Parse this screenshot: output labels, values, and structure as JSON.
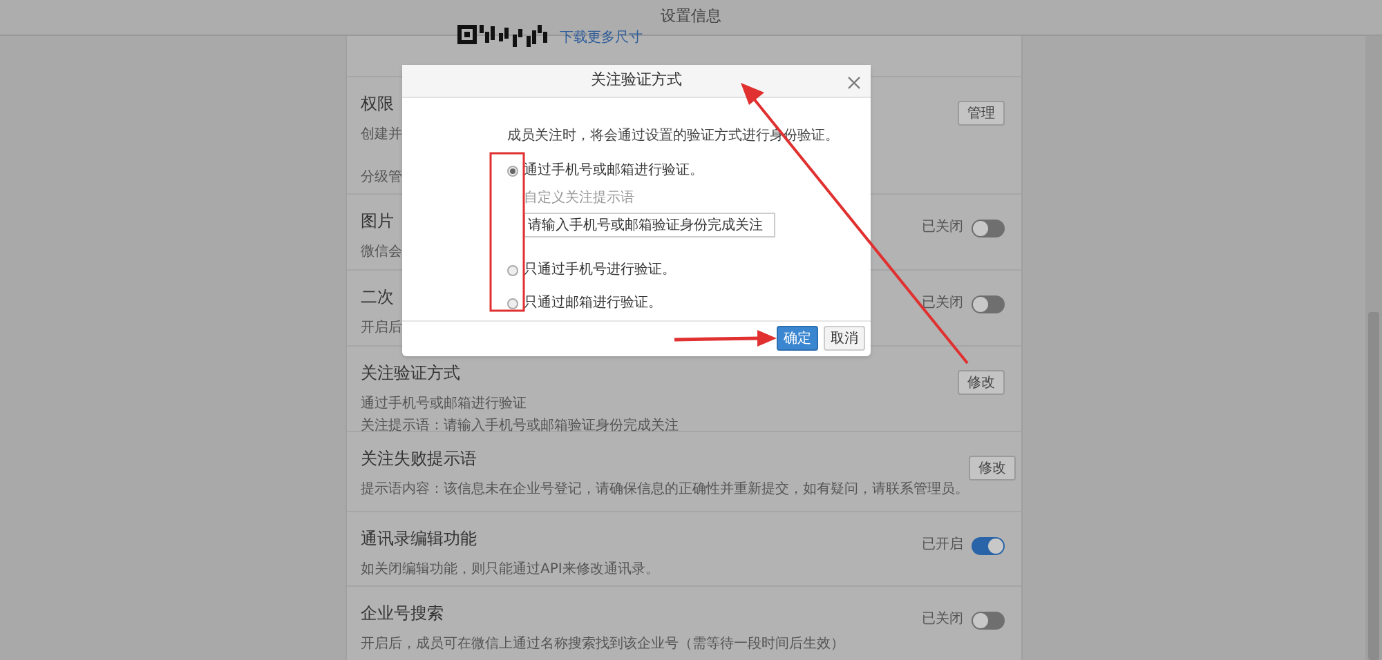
{
  "header": {
    "title": "设置信息"
  },
  "qr_row": {
    "link": "下载更多尺寸"
  },
  "settings": [
    {
      "title": "权限",
      "description": [
        "创建并",
        "分级管"
      ],
      "control": {
        "kind": "button",
        "label": "管理"
      }
    },
    {
      "title": "图片",
      "description": [
        "微信会"
      ],
      "control": {
        "kind": "toggle",
        "status": "已关闭",
        "on": false
      }
    },
    {
      "title": "二次",
      "description": [
        "开启后"
      ],
      "control": {
        "kind": "toggle",
        "status": "已关闭",
        "on": false
      }
    },
    {
      "title": "关注验证方式",
      "description": [
        "通过手机号或邮箱进行验证",
        "关注提示语：请输入手机号或邮箱验证身份完成关注"
      ],
      "control": {
        "kind": "button",
        "label": "修改"
      }
    },
    {
      "title": "关注失败提示语",
      "description": [
        "提示语内容：该信息未在企业号登记，请确保信息的正确性并重新提交，如有疑问，请联系管理员。"
      ],
      "control": {
        "kind": "button",
        "label": "修改"
      }
    },
    {
      "title": "通讯录编辑功能",
      "description": [
        "如关闭编辑功能，则只能通过API来修改通讯录。"
      ],
      "control": {
        "kind": "toggle",
        "status": "已开启",
        "on": true
      }
    },
    {
      "title": "企业号搜索",
      "description": [
        "开启后，成员可在微信上通过名称搜索找到该企业号（需等待一段时间后生效）"
      ],
      "control": {
        "kind": "toggle",
        "status": "已关闭",
        "on": false
      }
    }
  ],
  "dialog": {
    "title": "关注验证方式",
    "intro": "成员关注时，将会通过设置的验证方式进行身份验证。",
    "options": [
      {
        "label": "通过手机号或邮箱进行验证。",
        "selected": true,
        "prompt": {
          "label": "自定义关注提示语",
          "value": "请输入手机号或邮箱验证身份完成关注"
        }
      },
      {
        "label": "只通过手机号进行验证。",
        "selected": false
      },
      {
        "label": "只通过邮箱进行验证。",
        "selected": false
      }
    ],
    "buttons": [
      {
        "label": "确定",
        "kind": "primary"
      },
      {
        "label": "取消",
        "kind": "secondary"
      }
    ]
  }
}
